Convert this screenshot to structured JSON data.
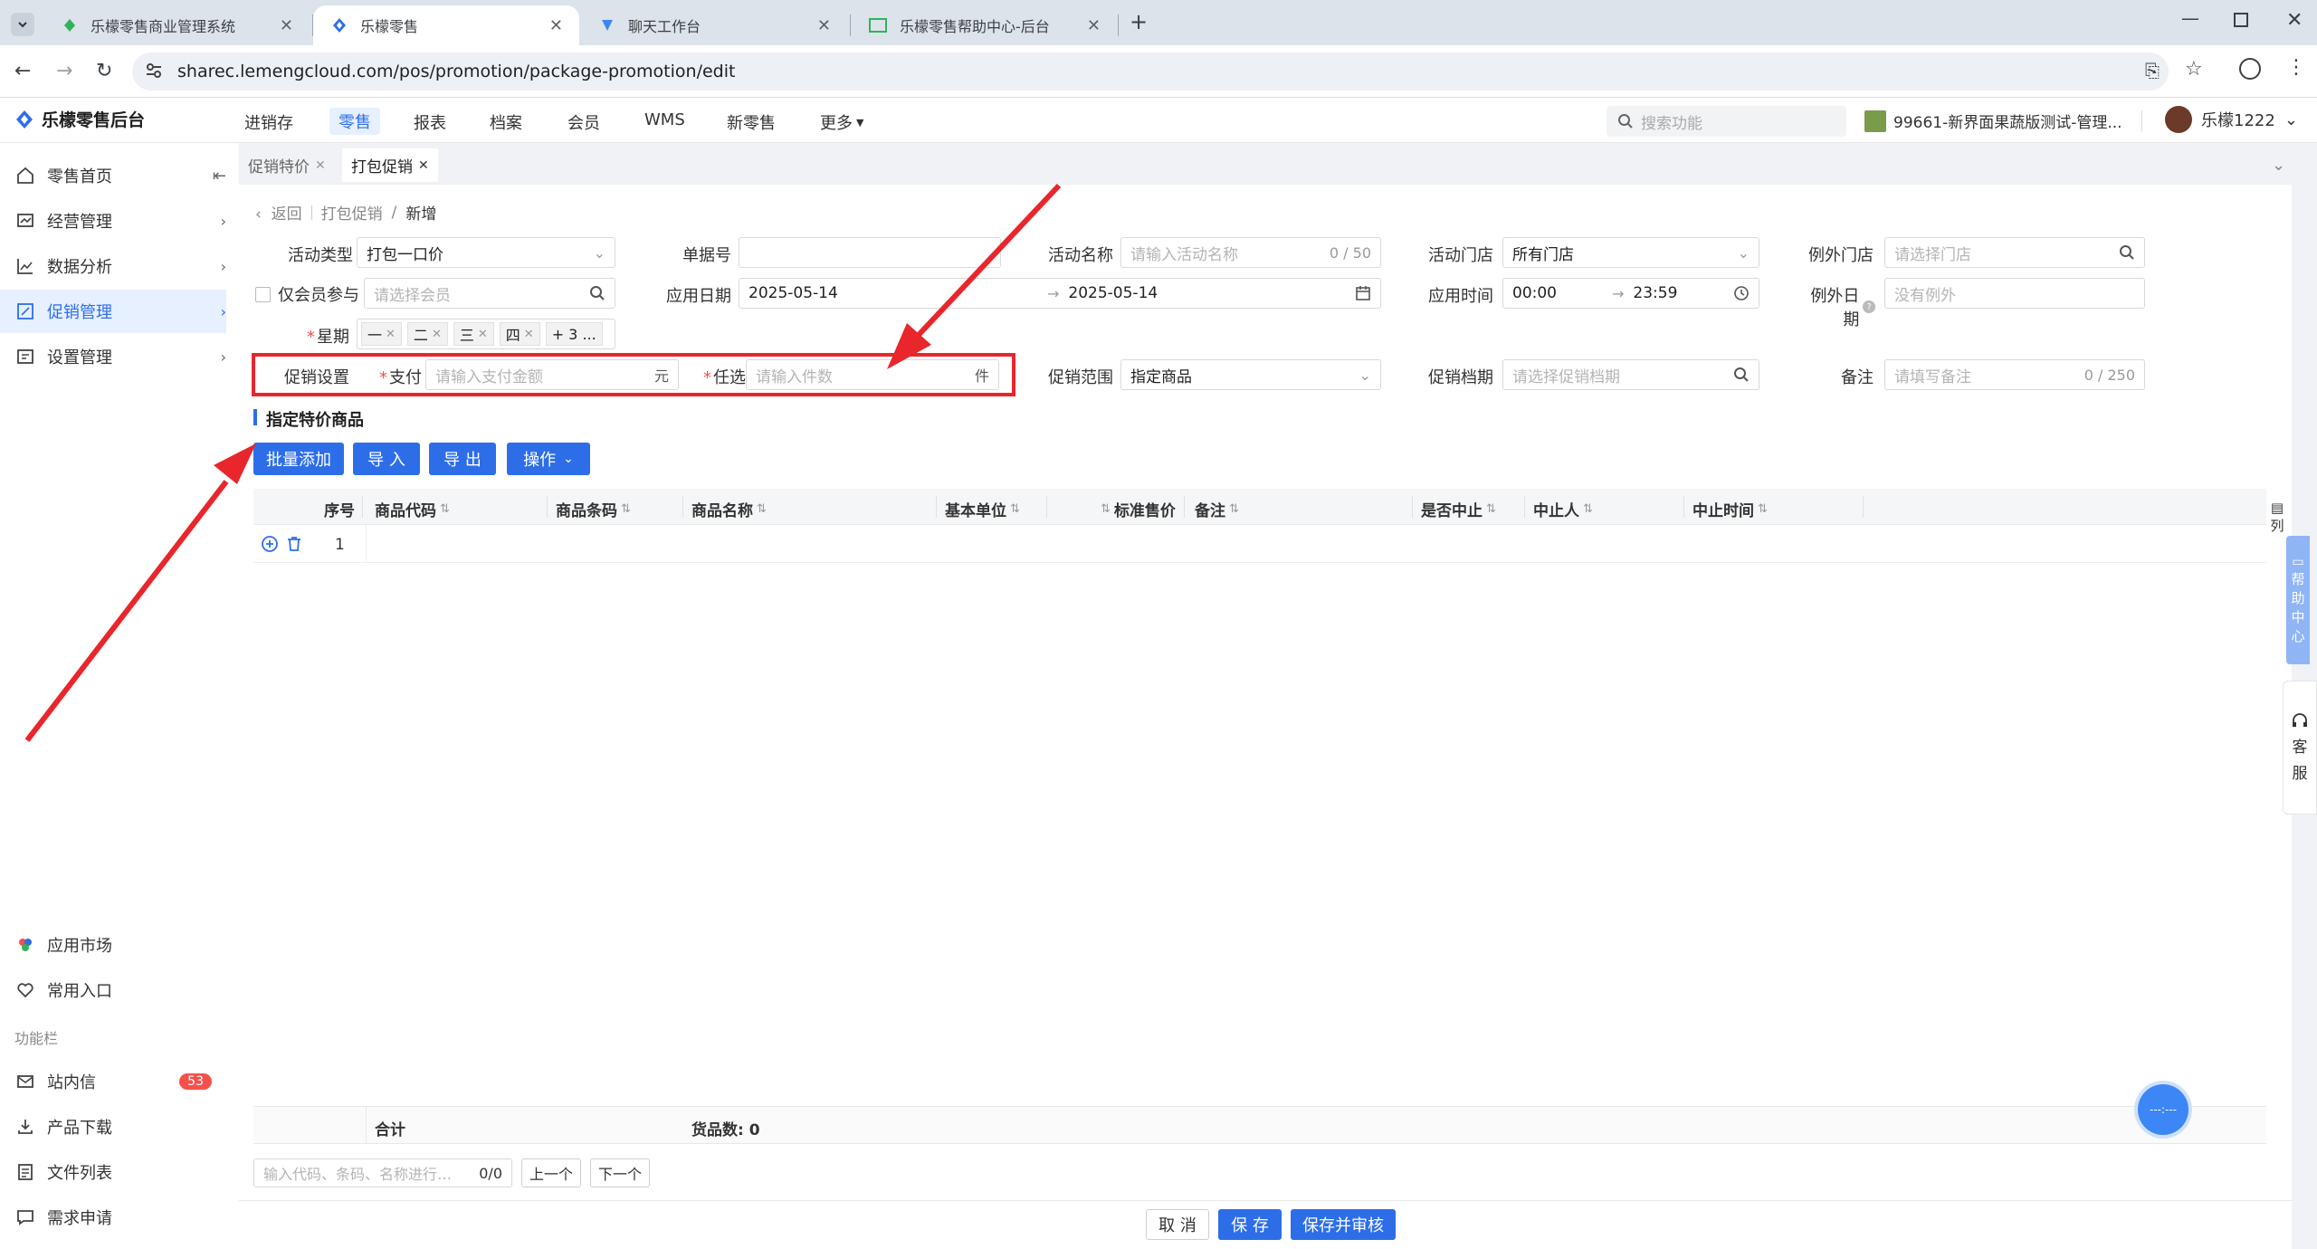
{
  "browser": {
    "tabs": [
      {
        "title": "乐檬零售商业管理系统"
      },
      {
        "title": "乐檬零售"
      },
      {
        "title": "聊天工作台"
      },
      {
        "title": "乐檬零售帮助中心-后台"
      }
    ],
    "url": "sharec.lemengcloud.com/pos/promotion/package-promotion/edit"
  },
  "header": {
    "brand": "乐檬零售后台",
    "nav": [
      "进销存",
      "零售",
      "报表",
      "档案",
      "会员",
      "WMS",
      "新零售",
      "更多"
    ],
    "active_nav": "零售",
    "search_placeholder": "搜索功能",
    "store": "99661-新界面果蔬版测试-管理...",
    "user": "乐檬1222"
  },
  "sidebar": {
    "items": [
      {
        "label": "零售首页",
        "icon": "home-icon"
      },
      {
        "label": "经营管理",
        "icon": "chart-board-icon"
      },
      {
        "label": "数据分析",
        "icon": "line-chart-icon"
      },
      {
        "label": "促销管理",
        "icon": "promotion-icon"
      },
      {
        "label": "设置管理",
        "icon": "settings-icon"
      }
    ],
    "bottom": [
      {
        "label": "应用市场",
        "icon": "app-market-icon"
      },
      {
        "label": "常用入口",
        "icon": "heart-icon"
      }
    ],
    "group_label": "功能栏",
    "tools": [
      {
        "label": "站内信",
        "icon": "mail-icon",
        "badge": "53"
      },
      {
        "label": "产品下载",
        "icon": "download-icon"
      },
      {
        "label": "文件列表",
        "icon": "file-list-icon"
      },
      {
        "label": "需求申请",
        "icon": "request-icon"
      }
    ]
  },
  "page_tabs": [
    "促销特价",
    "打包促销"
  ],
  "breadcrumb": {
    "back": "返回",
    "parent": "打包促销",
    "current": "新增"
  },
  "form": {
    "activity_type": {
      "label": "活动类型",
      "value": "打包一口价"
    },
    "doc_no": {
      "label": "单据号",
      "value": ""
    },
    "activity_name": {
      "label": "活动名称",
      "placeholder": "请输入活动名称",
      "counter": "0 / 50"
    },
    "activity_store": {
      "label": "活动门店",
      "value": "所有门店"
    },
    "exclude_store": {
      "label": "例外门店",
      "placeholder": "请选择门店"
    },
    "member_only": {
      "label": "仅会员参与",
      "placeholder": "请选择会员"
    },
    "apply_date": {
      "label": "应用日期",
      "start": "2025-05-14",
      "end": "2025-05-14"
    },
    "apply_time": {
      "label": "应用时间",
      "start": "00:00",
      "end": "23:59"
    },
    "exclude_date": {
      "label": "例外日期",
      "placeholder": "没有例外"
    },
    "week": {
      "label": "星期",
      "tags": [
        "一",
        "二",
        "三",
        "四"
      ],
      "more": "+ 3 ..."
    },
    "promo_setting": {
      "label": "促销设置",
      "pay_label": "支付",
      "pay_placeholder": "请输入支付金额",
      "pay_unit": "元",
      "choose_label": "任选",
      "choose_placeholder": "请输入件数",
      "choose_unit": "件"
    },
    "promo_scope": {
      "label": "促销范围",
      "value": "指定商品"
    },
    "promo_schedule": {
      "label": "促销档期",
      "placeholder": "请选择促销档期"
    },
    "remark": {
      "label": "备注",
      "placeholder": "请填写备注",
      "counter": "0 / 250"
    }
  },
  "section_title": "指定特价商品",
  "toolbar": {
    "batch_add": "批量添加",
    "import": "导 入",
    "export": "导 出",
    "ops": "操作"
  },
  "table": {
    "columns": [
      "序号",
      "商品代码",
      "商品条码",
      "商品名称",
      "基本单位",
      "标准售价",
      "备注",
      "是否中止",
      "中止人",
      "中止时间"
    ],
    "rows": [
      {
        "seq": "1"
      }
    ],
    "footer": {
      "total_label": "合计",
      "count_label": "货品数: 0"
    }
  },
  "finder": {
    "placeholder": "输入代码、条码、名称进行…",
    "count": "0/0",
    "prev": "上一个",
    "next": "下一个"
  },
  "right_rail": {
    "columns": "列",
    "help": [
      "帮",
      "助",
      "中",
      "心"
    ],
    "service": [
      "客",
      "服"
    ]
  },
  "float_btn": "---:---",
  "actions": {
    "cancel": "取 消",
    "save": "保 存",
    "save_audit": "保存并审核"
  },
  "colors": {
    "primary": "#2d6ee8",
    "annotation": "#e8262b"
  }
}
